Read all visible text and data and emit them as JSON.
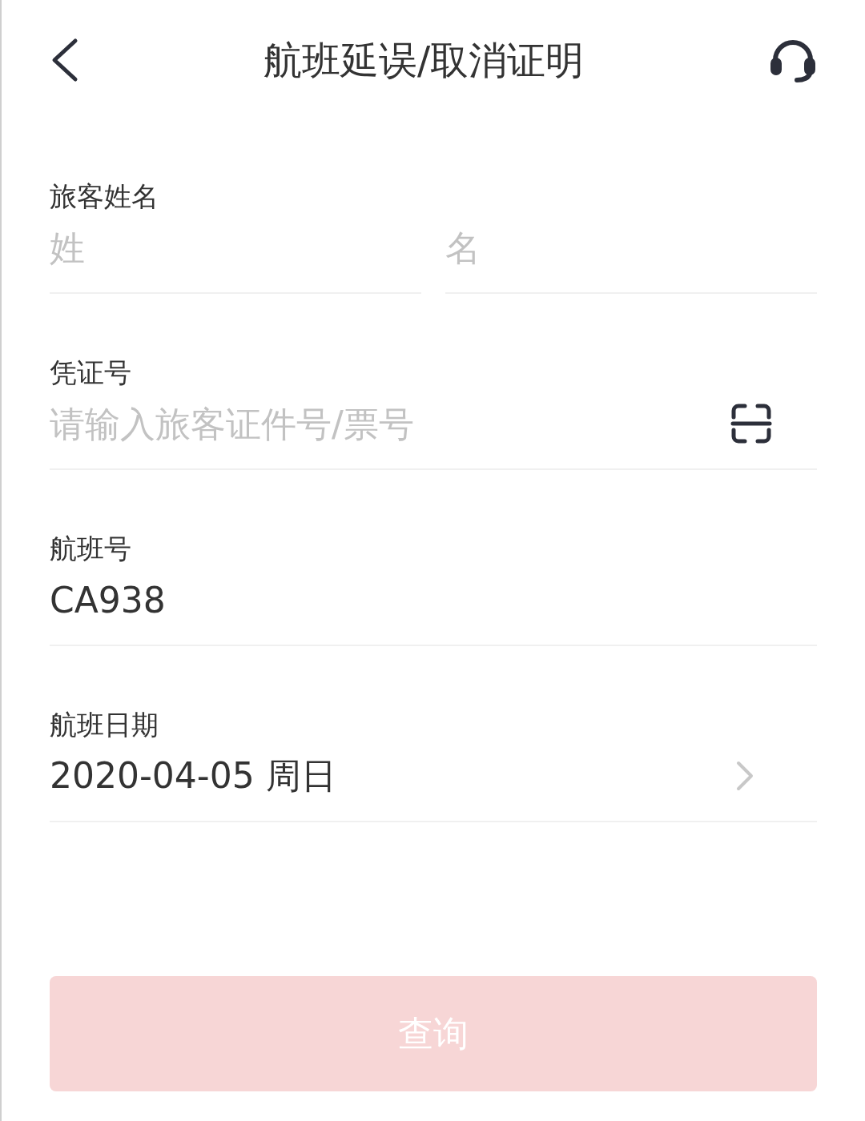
{
  "header": {
    "title": "航班延误/取消证明"
  },
  "fields": [
    {
      "kind": "name",
      "label": "旅客姓名",
      "inputs": [
        {
          "placeholder": "姓"
        },
        {
          "placeholder": "名"
        }
      ]
    },
    {
      "kind": "scan",
      "label": "凭证号",
      "placeholder": "请输入旅客证件号/票号"
    },
    {
      "kind": "text",
      "label": "航班号",
      "value": "CA938"
    },
    {
      "kind": "picker",
      "label": "航班日期",
      "value": "2020-04-05 周日"
    }
  ],
  "submit": {
    "label": "查询",
    "disabled": true
  }
}
